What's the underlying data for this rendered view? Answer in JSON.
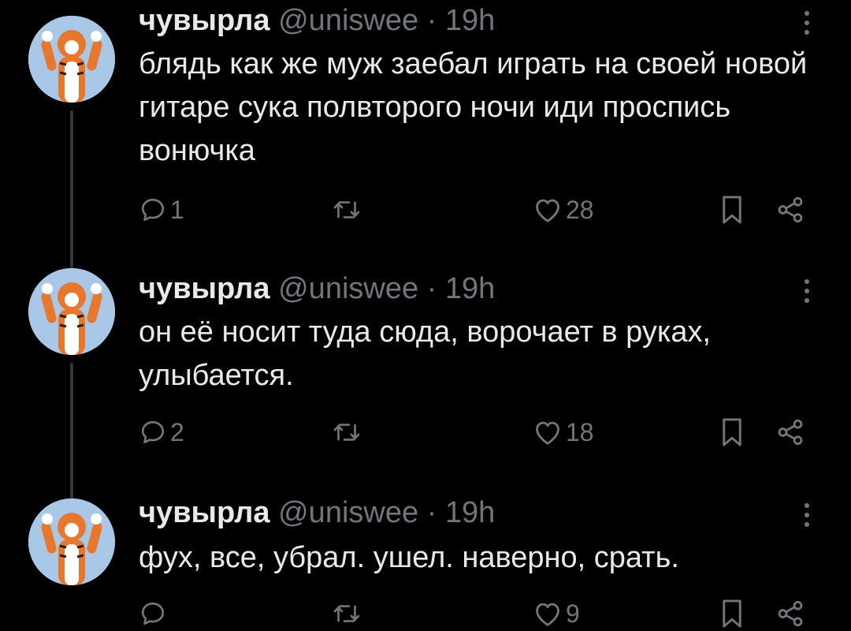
{
  "tweets": [
    {
      "name": "чувырла",
      "meta": "@uniswee · 19h",
      "text": "блядь как же муж заебал играть на своей новой гитаре сука полвторого ночи иди проспись вонючка",
      "replies": "1",
      "retweets": "",
      "likes": "28"
    },
    {
      "name": "чувырла",
      "meta": "@uniswee · 19h",
      "text": "он её носит туда сюда, ворочает в руках, улыбается.",
      "replies": "2",
      "retweets": "",
      "likes": "18"
    },
    {
      "name": "чувырла",
      "meta": "@uniswee · 19h",
      "text": "фух, все, убрал. ушел. наверно, срать.",
      "replies": "",
      "retweets": "",
      "likes": "9"
    }
  ],
  "colors": {
    "background": "#000000",
    "text": "#e7e9ea",
    "secondary": "#71767b",
    "thread_line": "#333639",
    "avatar_bg": "#a9c7e6"
  },
  "icons": [
    "reply-icon",
    "retweet-icon",
    "like-icon",
    "bookmark-icon",
    "share-icon",
    "more-icon"
  ]
}
